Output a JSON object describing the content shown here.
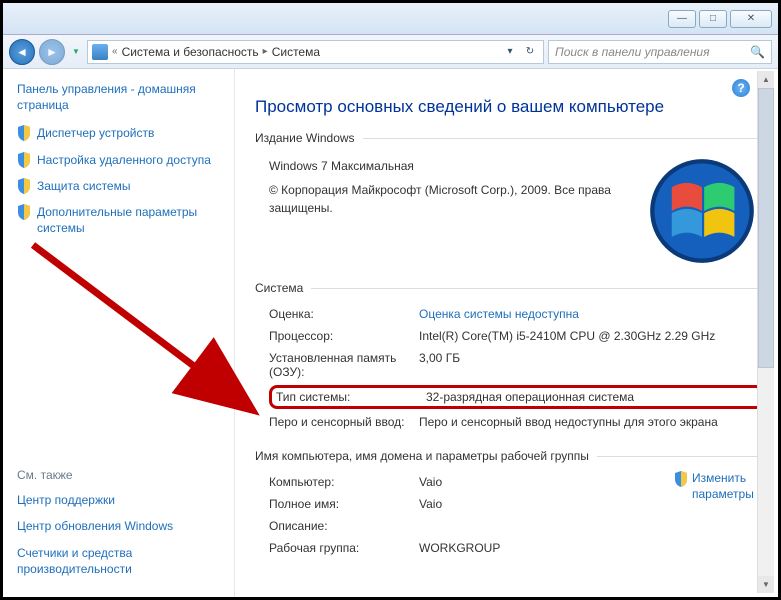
{
  "titlebar": {
    "min": "—",
    "max": "□",
    "close": "✕"
  },
  "toolbar": {
    "back": "◄",
    "fwd": "►",
    "drop": "▼",
    "breadcrumb": {
      "part1": "Система и безопасность",
      "part2": "Система",
      "sep": "▸",
      "pre": "«"
    },
    "refresh": "↻",
    "down": "▾",
    "search_placeholder": "Поиск в панели управления"
  },
  "sidebar": {
    "head": "Панель управления - домашняя страница",
    "links": [
      "Диспетчер устройств",
      "Настройка удаленного доступа",
      "Защита системы",
      "Дополнительные параметры системы"
    ],
    "seealso_head": "См. также",
    "seealso": [
      "Центр поддержки",
      "Центр обновления Windows",
      "Счетчики и средства производительности"
    ]
  },
  "main": {
    "title": "Просмотр основных сведений о вашем компьютере",
    "edition": {
      "legend": "Издание Windows",
      "name": "Windows 7 Максимальная",
      "copyright": "© Корпорация Майкрософт (Microsoft Corp.), 2009. Все права защищены."
    },
    "system": {
      "legend": "Система",
      "rows": {
        "rating_label": "Оценка:",
        "rating_value": "Оценка системы недоступна",
        "cpu_label": "Процессор:",
        "cpu_value": "Intel(R) Core(TM) i5-2410M CPU @ 2.30GHz   2.29 GHz",
        "ram_label": "Установленная память (ОЗУ):",
        "ram_value": "3,00 ГБ",
        "type_label": "Тип системы:",
        "type_value": "32-разрядная операционная система",
        "pen_label": "Перо и сенсорный ввод:",
        "pen_value": "Перо и сенсорный ввод недоступны для этого экрана"
      }
    },
    "computer": {
      "legend": "Имя компьютера, имя домена и параметры рабочей группы",
      "rows": {
        "comp_label": "Компьютер:",
        "comp_value": "Vaio",
        "full_label": "Полное имя:",
        "full_value": "Vaio",
        "desc_label": "Описание:",
        "desc_value": "",
        "wg_label": "Рабочая группа:",
        "wg_value": "WORKGROUP"
      },
      "change": "Изменить параметры"
    }
  }
}
